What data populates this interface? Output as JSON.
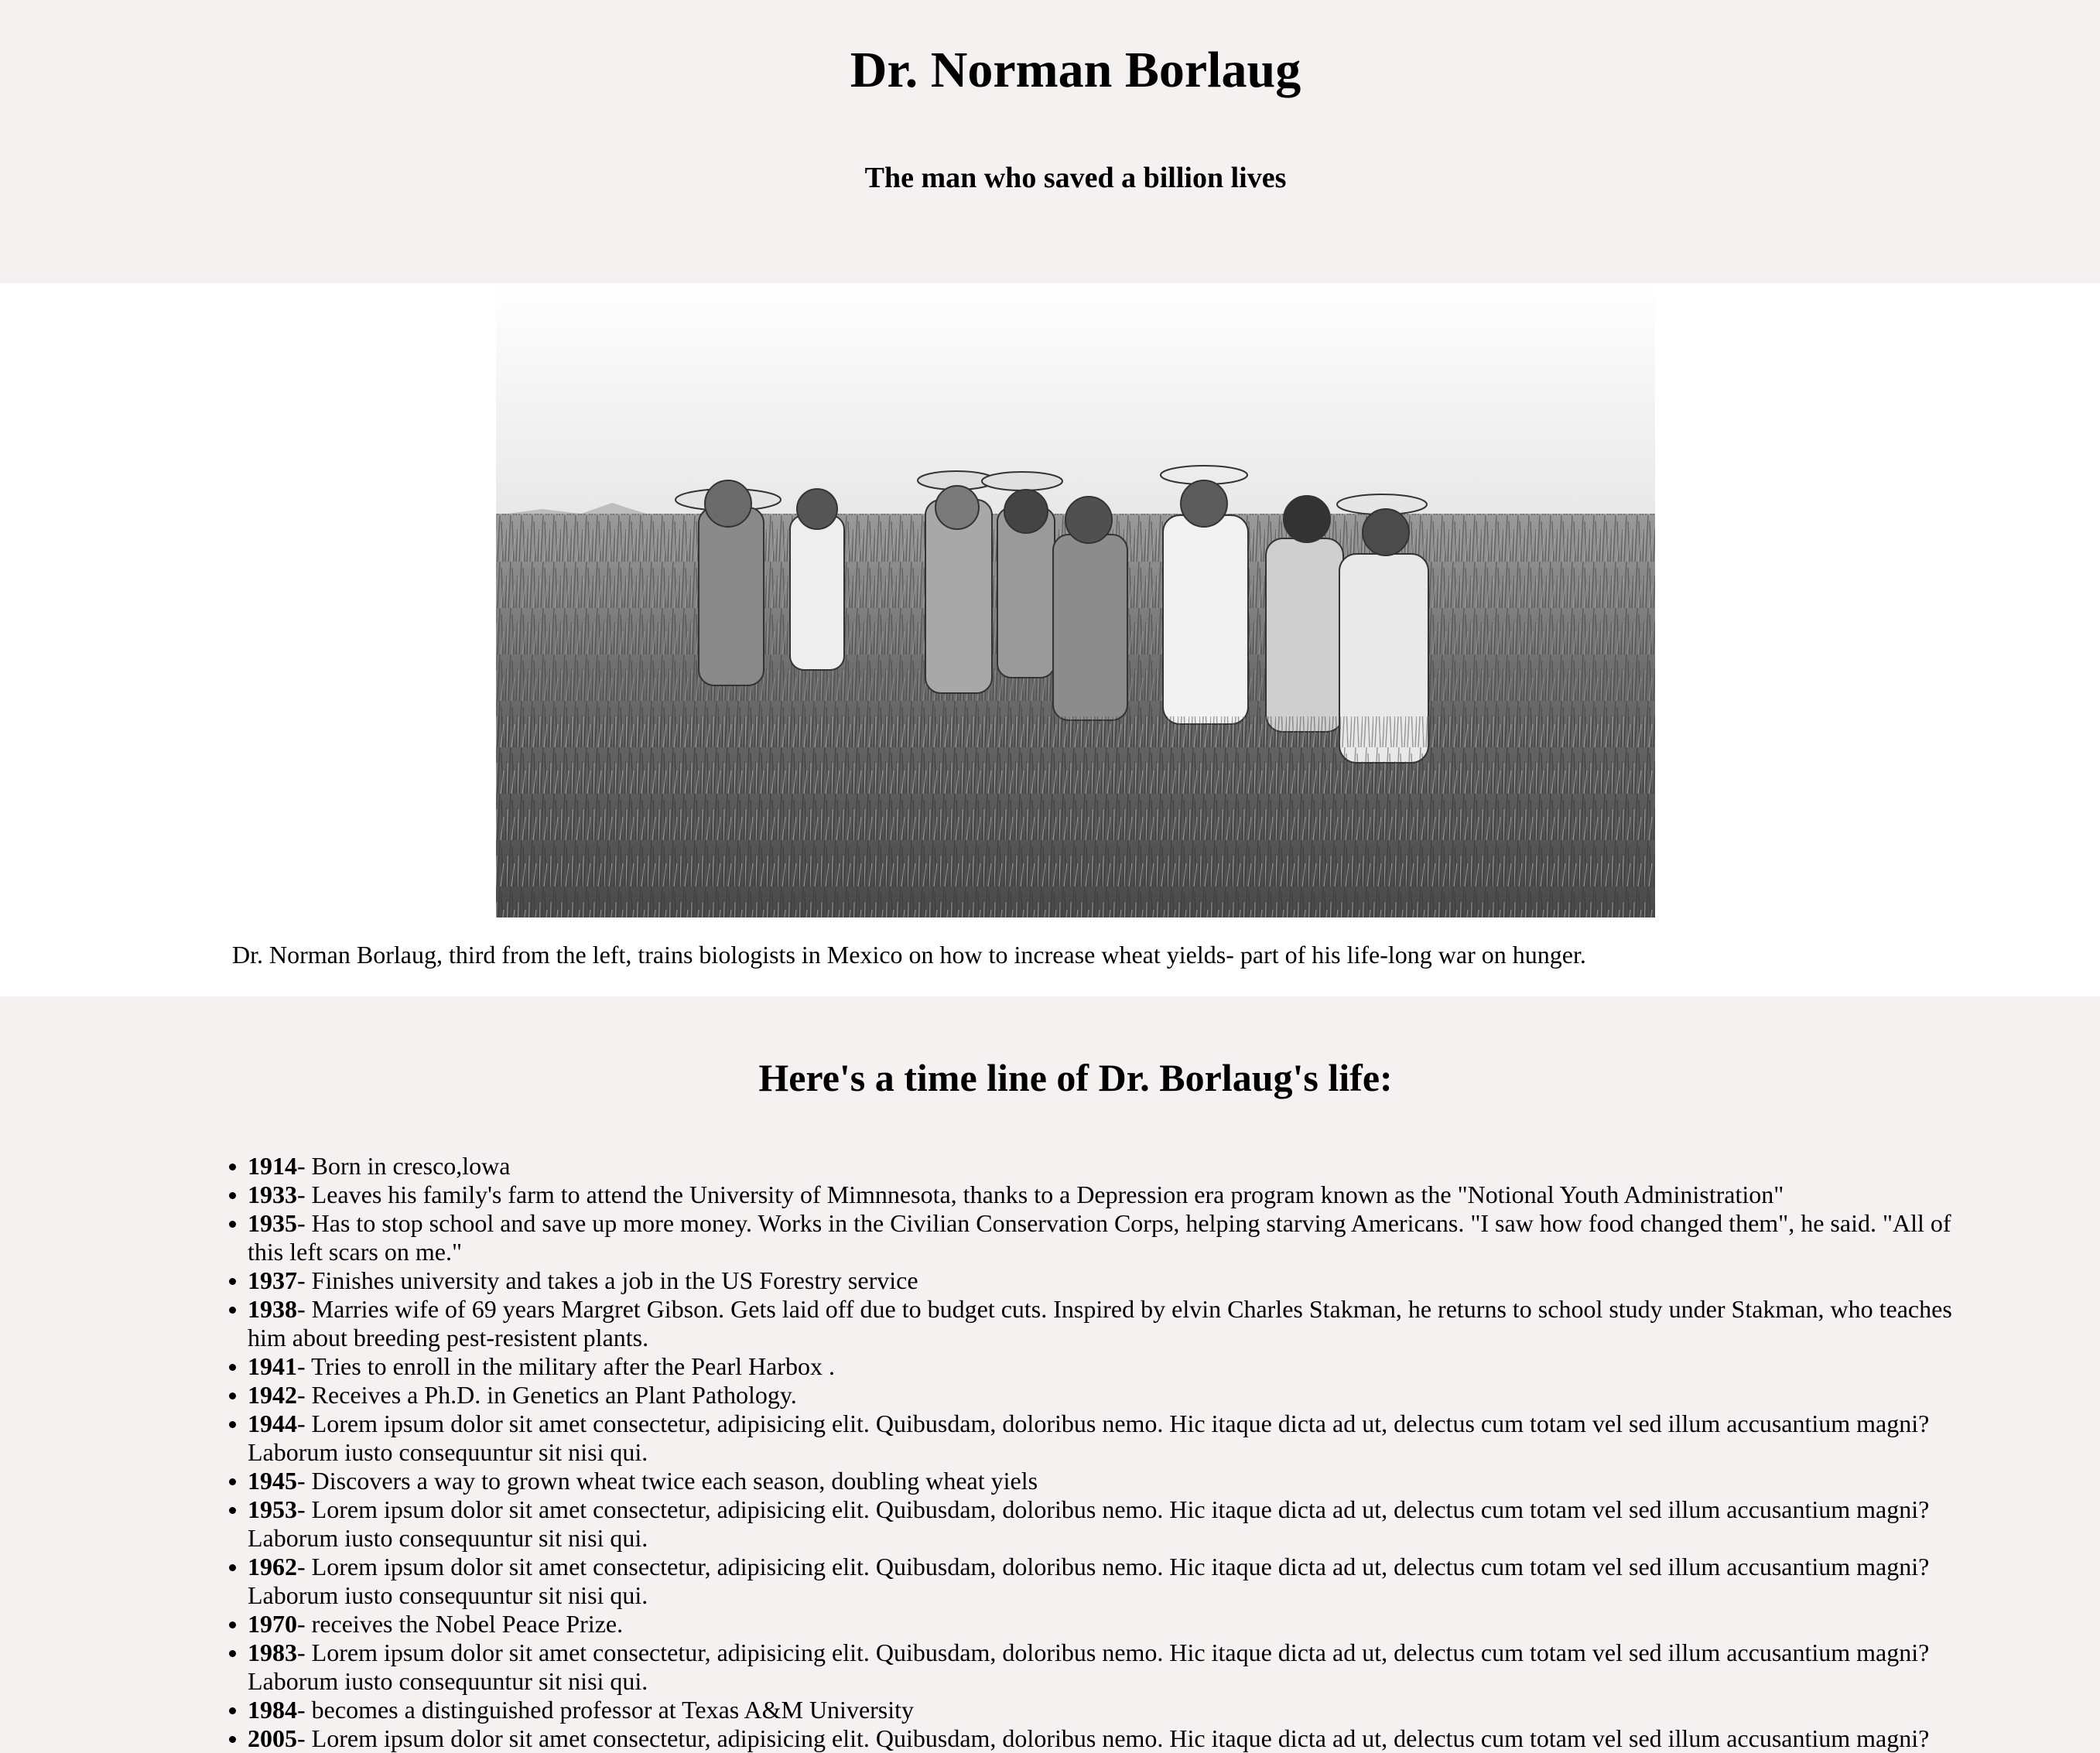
{
  "header": {
    "title": "Dr. Norman Borlaug",
    "subtitle": "The man who saved a billion lives"
  },
  "image": {
    "alt": "Dr. Norman Borlaug and biologists standing in a wheat field",
    "caption": "Dr. Norman Borlaug, third from the left, trains biologists in Mexico on how to increase wheat yields- part of his life-long war on hunger."
  },
  "timeline": {
    "heading": "Here's a time line of Dr. Borlaug's life:",
    "items": [
      {
        "year": "1914",
        "text": "- Born in cresco,lowa"
      },
      {
        "year": "1933",
        "text": "- Leaves his family's farm to attend the University of Mimnnesota, thanks to a Depression era program known as the \"Notional Youth Administration\""
      },
      {
        "year": "1935",
        "text": "- Has to stop school and save up more money. Works in the Civilian Conservation Corps, helping starving Americans. \"I saw how food changed them\", he said. \"All of this left scars on me.\""
      },
      {
        "year": "1937",
        "text": "- Finishes university and takes a job in the US Forestry service"
      },
      {
        "year": "1938",
        "text": "- Marries wife of 69 years Margret Gibson. Gets laid off due to budget cuts. Inspired by elvin Charles Stakman, he returns to school study under Stakman, who teaches him about breeding pest-resistent plants."
      },
      {
        "year": "1941",
        "text": "- Tries to enroll in the military after the Pearl Harbox ."
      },
      {
        "year": "1942",
        "text": "- Receives a Ph.D. in Genetics an Plant Pathology."
      },
      {
        "year": "1944",
        "text": "- Lorem ipsum dolor sit amet consectetur, adipisicing elit. Quibusdam, doloribus nemo. Hic itaque dicta ad ut, delectus cum totam vel sed illum accusantium magni? Laborum iusto consequuntur sit nisi qui."
      },
      {
        "year": "1945",
        "text": "- Discovers a way to grown wheat twice each season, doubling wheat yiels"
      },
      {
        "year": "1953",
        "text": "- Lorem ipsum dolor sit amet consectetur, adipisicing elit. Quibusdam, doloribus nemo. Hic itaque dicta ad ut, delectus cum totam vel sed illum accusantium magni? Laborum iusto consequuntur sit nisi qui."
      },
      {
        "year": "1962",
        "text": "- Lorem ipsum dolor sit amet consectetur, adipisicing elit. Quibusdam, doloribus nemo. Hic itaque dicta ad ut, delectus cum totam vel sed illum accusantium magni? Laborum iusto consequuntur sit nisi qui."
      },
      {
        "year": "1970",
        "text": "- receives the Nobel Peace Prize."
      },
      {
        "year": "1983",
        "text": "- Lorem ipsum dolor sit amet consectetur, adipisicing elit. Quibusdam, doloribus nemo. Hic itaque dicta ad ut, delectus cum totam vel sed illum accusantium magni? Laborum iusto consequuntur sit nisi qui."
      },
      {
        "year": "1984",
        "text": "- becomes a distinguished professor at Texas A&M University"
      },
      {
        "year": "2005",
        "text": "- Lorem ipsum dolor sit amet consectetur, adipisicing elit. Quibusdam, doloribus nemo. Hic itaque dicta ad ut, delectus cum totam vel sed illum accusantium magni?"
      }
    ]
  }
}
